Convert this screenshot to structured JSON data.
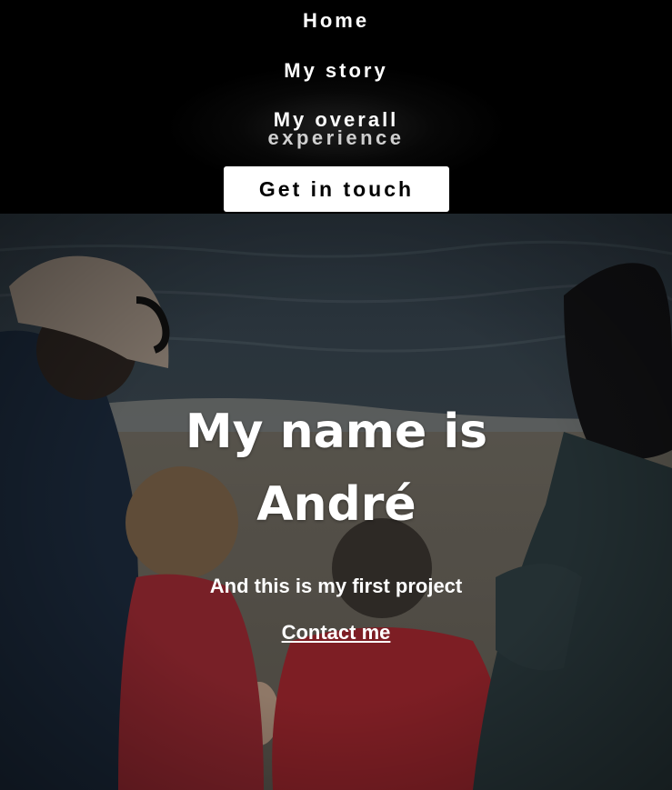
{
  "nav": {
    "items": [
      {
        "label": "Home"
      },
      {
        "label": "My story"
      },
      {
        "label_line1": "My overall",
        "label_line2": "experience"
      }
    ],
    "cta_label": "Get in touch"
  },
  "hero": {
    "title_line1": "My name is",
    "title_line2": "André",
    "subtitle": "And this is my first project",
    "link_label": "Contact me"
  }
}
